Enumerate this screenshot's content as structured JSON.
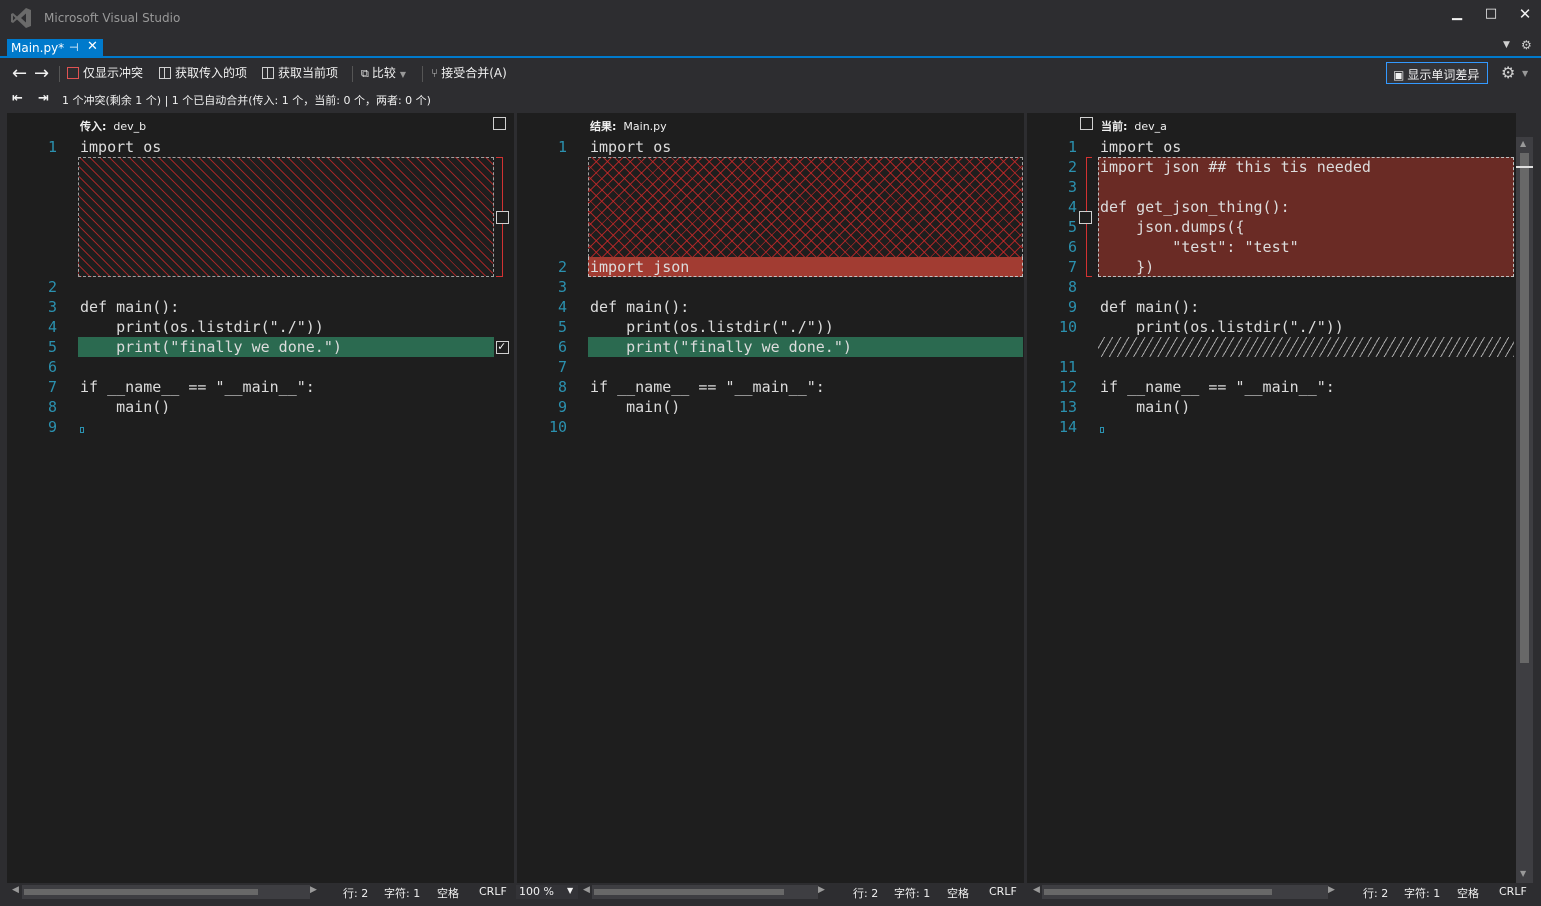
{
  "window": {
    "title": "Microsoft Visual Studio",
    "minimize": "▁",
    "maximize": "□",
    "close": "✕"
  },
  "tab": {
    "label": "Main.py*",
    "pin": "⊣",
    "close": "✕"
  },
  "toolbar": {
    "back": "←",
    "forward": "→",
    "conflicts_only": "仅显示冲突",
    "take_incoming": "获取传入的项",
    "take_current": "获取当前项",
    "compare": "比较",
    "accept_merge": "接受合并(A)",
    "word_diff": "显示单词差异",
    "settings": "⚙"
  },
  "infobar": {
    "prev": "⇤",
    "next": "⇥",
    "summary": "1 个冲突(剩余 1 个) | 1 个已自动合并(传入: 1 个，当前: 0 个，两者: 0 个)"
  },
  "panes": {
    "incoming": {
      "label": "传入:",
      "branch": "dev_b",
      "lines": [
        {
          "n": "1",
          "text": "import os"
        },
        {
          "n": "2",
          "text": ""
        },
        {
          "n": "3",
          "text": "def main():"
        },
        {
          "n": "4",
          "text": "    print(os.listdir(\"./\"))"
        },
        {
          "n": "5",
          "text": "    print(\"finally we done.\")"
        },
        {
          "n": "6",
          "text": ""
        },
        {
          "n": "7",
          "text": "if __name__ == \"__main__\":"
        },
        {
          "n": "8",
          "text": "    main()"
        },
        {
          "n": "9",
          "text": ""
        }
      ]
    },
    "result": {
      "label": "结果:",
      "file": "Main.py",
      "lines": [
        {
          "n": "1",
          "text": "import os"
        },
        {
          "n": "2",
          "text": "import json"
        },
        {
          "n": "3",
          "text": ""
        },
        {
          "n": "4",
          "text": "def main():"
        },
        {
          "n": "5",
          "text": "    print(os.listdir(\"./\"))"
        },
        {
          "n": "6",
          "text": "    print(\"finally we done.\")"
        },
        {
          "n": "7",
          "text": ""
        },
        {
          "n": "8",
          "text": "if __name__ == \"__main__\":"
        },
        {
          "n": "9",
          "text": "    main()"
        },
        {
          "n": "10",
          "text": ""
        }
      ]
    },
    "current": {
      "label": "当前:",
      "branch": "dev_a",
      "lines": [
        {
          "n": "1",
          "text": "import os"
        },
        {
          "n": "2",
          "text": "import json ## this tis needed"
        },
        {
          "n": "3",
          "text": ""
        },
        {
          "n": "4",
          "text": "def get_json_thing():"
        },
        {
          "n": "5",
          "text": "    json.dumps({"
        },
        {
          "n": "6",
          "text": "        \"test\": \"test\""
        },
        {
          "n": "7",
          "text": "    })"
        },
        {
          "n": "8",
          "text": ""
        },
        {
          "n": "9",
          "text": "def main():"
        },
        {
          "n": "10",
          "text": "    print(os.listdir(\"./\"))"
        },
        {
          "n": "11",
          "text": ""
        },
        {
          "n": "12",
          "text": "if __name__ == \"__main__\":"
        },
        {
          "n": "13",
          "text": "    main()"
        },
        {
          "n": "14",
          "text": ""
        }
      ]
    }
  },
  "status": {
    "row": "行: 2",
    "col": "字符: 1",
    "spaces": "空格",
    "eol": "CRLF",
    "zoom": "100 %"
  },
  "colors": {
    "accent": "#007acc",
    "added_green": "#2b6a50",
    "conflict_red": "#a23c32",
    "line_number": "#2b91af"
  }
}
